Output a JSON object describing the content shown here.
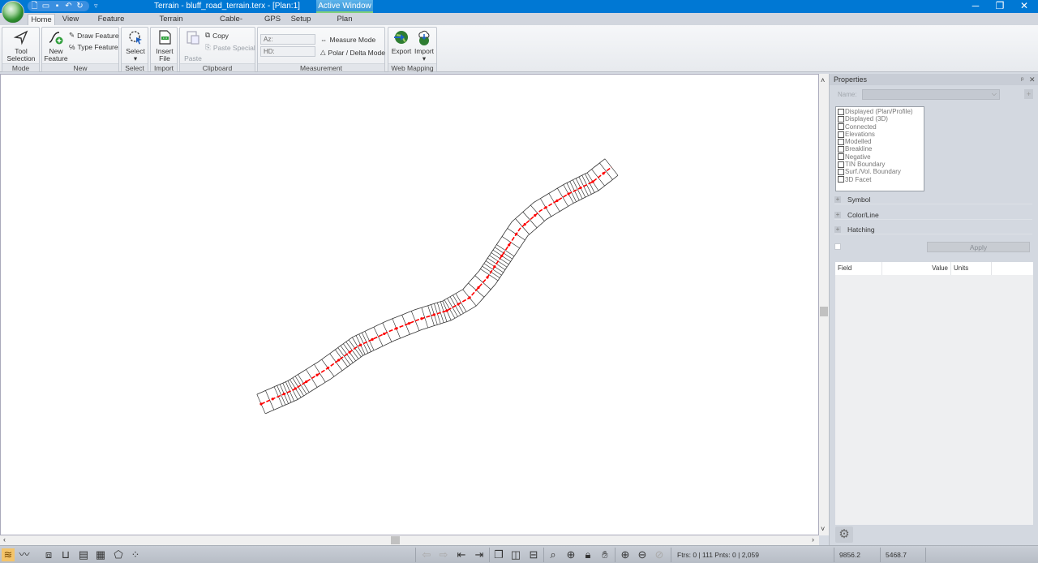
{
  "window": {
    "title": "Terrain - bluff_road_terrain.terx - [Plan:1]",
    "active_window_label": "Active Window",
    "contextual_tab": "Plan",
    "minimize_icon": "minimize-icon",
    "restore_icon": "restore-icon",
    "close_icon": "close-icon"
  },
  "quick_access": [
    {
      "icon": "new-file-icon"
    },
    {
      "icon": "open-folder-icon"
    },
    {
      "icon": "save-icon"
    },
    {
      "icon": "undo-icon"
    },
    {
      "icon": "redo-icon"
    }
  ],
  "tabs": [
    "Home",
    "View",
    "Feature Tools",
    "Terrain Modeling",
    "Cable-Analysis",
    "GPS",
    "Setup",
    "Plan"
  ],
  "active_tab": "Home",
  "ribbon": {
    "mode": {
      "label": "Mode",
      "tool_selection": "Tool",
      "tool_selection2": "Selection"
    },
    "new": {
      "label": "New",
      "new_feature": "New",
      "new_feature2": "Feature",
      "draw_feature": "Draw Feature",
      "type_feature": "Type Feature"
    },
    "select": {
      "label": "Select",
      "select": "Select"
    },
    "import": {
      "label": "Import",
      "insert_file": "Insert",
      "insert_file2": "File"
    },
    "clipboard": {
      "label": "Clipboard",
      "paste": "Paste",
      "copy": "Copy",
      "paste_special": "Paste Special"
    },
    "measurement": {
      "label": "Measurement",
      "az_placeholder": "Az:",
      "hd_placeholder": "HD:",
      "measure_mode": "Measure Mode",
      "polar_delta_mode": "Polar / Delta Mode"
    },
    "web_mapping": {
      "label": "Web Mapping",
      "export": "Export",
      "import": "Import"
    }
  },
  "properties": {
    "title": "Properties",
    "name_label": "Name:",
    "name_value": "",
    "flags": [
      {
        "label": "Displayed (Plan/Profile)",
        "checked": false
      },
      {
        "label": "Displayed (3D)",
        "checked": false
      },
      {
        "label": "Connected",
        "checked": false
      },
      {
        "label": "Elevations",
        "checked": false
      },
      {
        "label": "Modelled",
        "checked": false
      },
      {
        "label": "Breakline",
        "checked": false
      },
      {
        "label": "Negative",
        "checked": false
      },
      {
        "label": "TIN Boundary",
        "checked": false
      },
      {
        "label": "Surf./Vol. Boundary",
        "checked": false
      },
      {
        "label": "3D Facet",
        "checked": false
      }
    ],
    "sections": [
      "Symbol",
      "Color/Line",
      "Hatching"
    ],
    "apply_label": "Apply",
    "grid_columns": [
      "Field",
      "Value",
      "Units"
    ]
  },
  "status": {
    "counts": "Ftrs: 0 | 111  Pnts: 0 | 2,059",
    "x_coord": "9856.2",
    "y_coord": "5468.7"
  },
  "colors": {
    "titlebar": "#0078d4",
    "centerline": "#ff0000",
    "section_lines": "#222222"
  }
}
